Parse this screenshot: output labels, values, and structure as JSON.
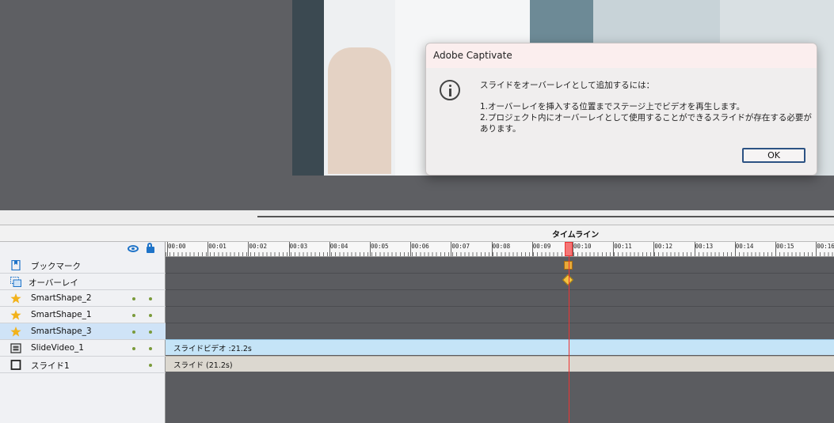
{
  "dialog": {
    "title": "Adobe Captivate",
    "message_heading": "スライドをオーバーレイとして追加するには：",
    "step1": "1.オーバーレイを挿入する位置までステージ上でビデオを再生します。",
    "step2_line1": "2.プロジェクト内にオーバーレイとして使用することができるスライドが存在する必要が",
    "step2_line2": "あります。",
    "ok_label": "OK",
    "icon": "info-icon"
  },
  "timeline": {
    "title": "タイムライン",
    "ruler_labels": [
      "00:00",
      "00:01",
      "00:02",
      "00:03",
      "00:04",
      "00:05",
      "00:06",
      "00:07",
      "00:08",
      "00:09",
      "00:10",
      "00:11",
      "00:12",
      "00:13",
      "00:14",
      "00:15",
      "00:16"
    ],
    "header_icons": [
      "eye-icon",
      "lock-icon"
    ],
    "playhead_seconds": 9.9
  },
  "layers": [
    {
      "label": "ブックマーク",
      "icon": "bookmark-icon"
    },
    {
      "label": "オーバーレイ",
      "icon": "overlay-icon"
    },
    {
      "label": "SmartShape_2",
      "icon": "star-icon"
    },
    {
      "label": "SmartShape_1",
      "icon": "star-icon"
    },
    {
      "label": "SmartShape_3",
      "icon": "star-icon",
      "selected": true
    },
    {
      "label": "SlideVideo_1",
      "icon": "video-icon"
    },
    {
      "label": "スライド1",
      "icon": "slide-icon"
    }
  ],
  "clips": {
    "video_label": "スライドビデオ :21.2s",
    "slide_label": "スライド (21.2s)"
  },
  "colors": {
    "accent": "#1e73c8",
    "playhead": "#e33333",
    "video_clip": "#c5e4f7",
    "slide_clip": "#dcd8d0",
    "dialog_ok_border": "#2c5283"
  }
}
